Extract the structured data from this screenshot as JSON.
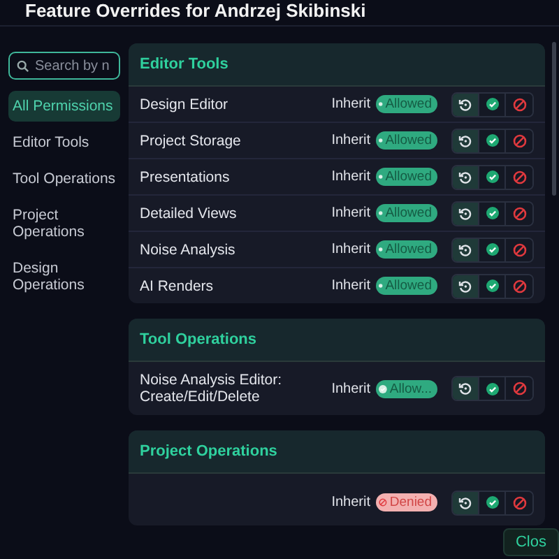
{
  "title": "Feature Overrides for Andrzej Skibinski",
  "search": {
    "placeholder": "Search by n"
  },
  "sidebar": {
    "items": [
      {
        "label": "All Permissions",
        "selected": true
      },
      {
        "label": "Editor Tools",
        "selected": false
      },
      {
        "label": "Tool Operations",
        "selected": false
      },
      {
        "label": "Project Operations",
        "selected": false
      },
      {
        "label": "Design Operations",
        "selected": false
      }
    ]
  },
  "sections": [
    {
      "title": "Editor Tools",
      "rows": [
        {
          "label": "Design Editor",
          "source": "Inherit",
          "status": {
            "kind": "allowed",
            "text": "Allowed"
          },
          "modes": [
            {
              "kind": "inherit",
              "selected": true
            },
            {
              "kind": "allow",
              "selected": false
            },
            {
              "kind": "deny",
              "selected": false
            }
          ]
        },
        {
          "label": "Project Storage",
          "source": "Inherit",
          "status": {
            "kind": "allowed",
            "text": "Allowed"
          },
          "modes": [
            {
              "kind": "inherit",
              "selected": true
            },
            {
              "kind": "allow",
              "selected": false
            },
            {
              "kind": "deny",
              "selected": false
            }
          ]
        },
        {
          "label": "Presentations",
          "source": "Inherit",
          "status": {
            "kind": "allowed",
            "text": "Allowed"
          },
          "modes": [
            {
              "kind": "inherit",
              "selected": true
            },
            {
              "kind": "allow",
              "selected": false
            },
            {
              "kind": "deny",
              "selected": false
            }
          ]
        },
        {
          "label": "Detailed Views",
          "source": "Inherit",
          "status": {
            "kind": "allowed",
            "text": "Allowed"
          },
          "modes": [
            {
              "kind": "inherit",
              "selected": true
            },
            {
              "kind": "allow",
              "selected": false
            },
            {
              "kind": "deny",
              "selected": false
            }
          ]
        },
        {
          "label": "Noise Analysis",
          "source": "Inherit",
          "status": {
            "kind": "allowed",
            "text": "Allowed"
          },
          "modes": [
            {
              "kind": "inherit",
              "selected": true
            },
            {
              "kind": "allow",
              "selected": false
            },
            {
              "kind": "deny",
              "selected": false
            }
          ]
        },
        {
          "label": "AI Renders",
          "source": "Inherit",
          "status": {
            "kind": "allowed",
            "text": "Allowed"
          },
          "modes": [
            {
              "kind": "inherit",
              "selected": true
            },
            {
              "kind": "allow",
              "selected": false
            },
            {
              "kind": "deny",
              "selected": false
            }
          ]
        }
      ]
    },
    {
      "title": "Tool Operations",
      "rows": [
        {
          "label": "Noise Analysis Editor: Create/Edit/Delete",
          "source": "Inherit",
          "status": {
            "kind": "allowed",
            "text": "Allow..."
          },
          "modes": [
            {
              "kind": "inherit",
              "selected": true
            },
            {
              "kind": "allow",
              "selected": false
            },
            {
              "kind": "deny",
              "selected": false
            }
          ]
        }
      ]
    },
    {
      "title": "Project Operations",
      "rows": [
        {
          "source": "Inherit",
          "status": {
            "kind": "denied",
            "text": "Denied"
          },
          "modes": [
            {
              "kind": "inherit",
              "selected": true
            },
            {
              "kind": "allow",
              "selected": false
            },
            {
              "kind": "deny",
              "selected": false
            }
          ]
        }
      ]
    }
  ],
  "close_button": "Clos"
}
